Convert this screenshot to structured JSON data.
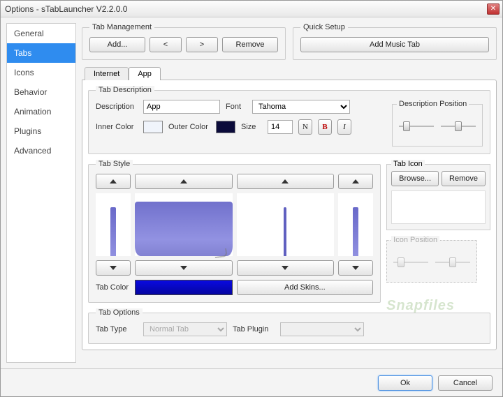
{
  "window": {
    "title": "Options - sTabLauncher V2.2.0.0"
  },
  "sidebar": {
    "items": [
      {
        "label": "General"
      },
      {
        "label": "Tabs"
      },
      {
        "label": "Icons"
      },
      {
        "label": "Behavior"
      },
      {
        "label": "Animation"
      },
      {
        "label": "Plugins"
      },
      {
        "label": "Advanced"
      }
    ],
    "selected_index": 1
  },
  "tab_management": {
    "legend": "Tab Management",
    "add": "Add...",
    "prev": "<",
    "next": ">",
    "remove": "Remove"
  },
  "quick_setup": {
    "legend": "Quick Setup",
    "add_music": "Add Music Tab"
  },
  "app_tabs": {
    "items": [
      {
        "label": "Internet"
      },
      {
        "label": "App"
      }
    ],
    "active_index": 1
  },
  "tab_description": {
    "legend": "Tab Description",
    "desc_label": "Description",
    "desc_value": "App",
    "font_label": "Font",
    "font_value": "Tahoma",
    "inner_color_label": "Inner Color",
    "inner_color_hex": "#f0f4fb",
    "outer_color_label": "Outer Color",
    "outer_color_hex": "#0b0b3a",
    "size_label": "Size",
    "size_value": "14",
    "n_btn": "N",
    "b_btn": "B",
    "i_btn": "I",
    "desc_pos_legend": "Description Position"
  },
  "tab_style": {
    "legend": "Tab Style",
    "tab_color_label": "Tab Color",
    "tab_color_hex": "#0808c8",
    "add_skins": "Add Skins..."
  },
  "tab_icon": {
    "legend": "Tab Icon",
    "browse": "Browse...",
    "remove": "Remove",
    "icon_pos_legend": "Icon Position"
  },
  "tab_options": {
    "legend": "Tab Options",
    "tab_type_label": "Tab Type",
    "tab_type_value": "Normal Tab",
    "tab_plugin_label": "Tab Plugin",
    "tab_plugin_value": ""
  },
  "footer": {
    "ok": "Ok",
    "cancel": "Cancel"
  },
  "watermark": "Snapfiles"
}
